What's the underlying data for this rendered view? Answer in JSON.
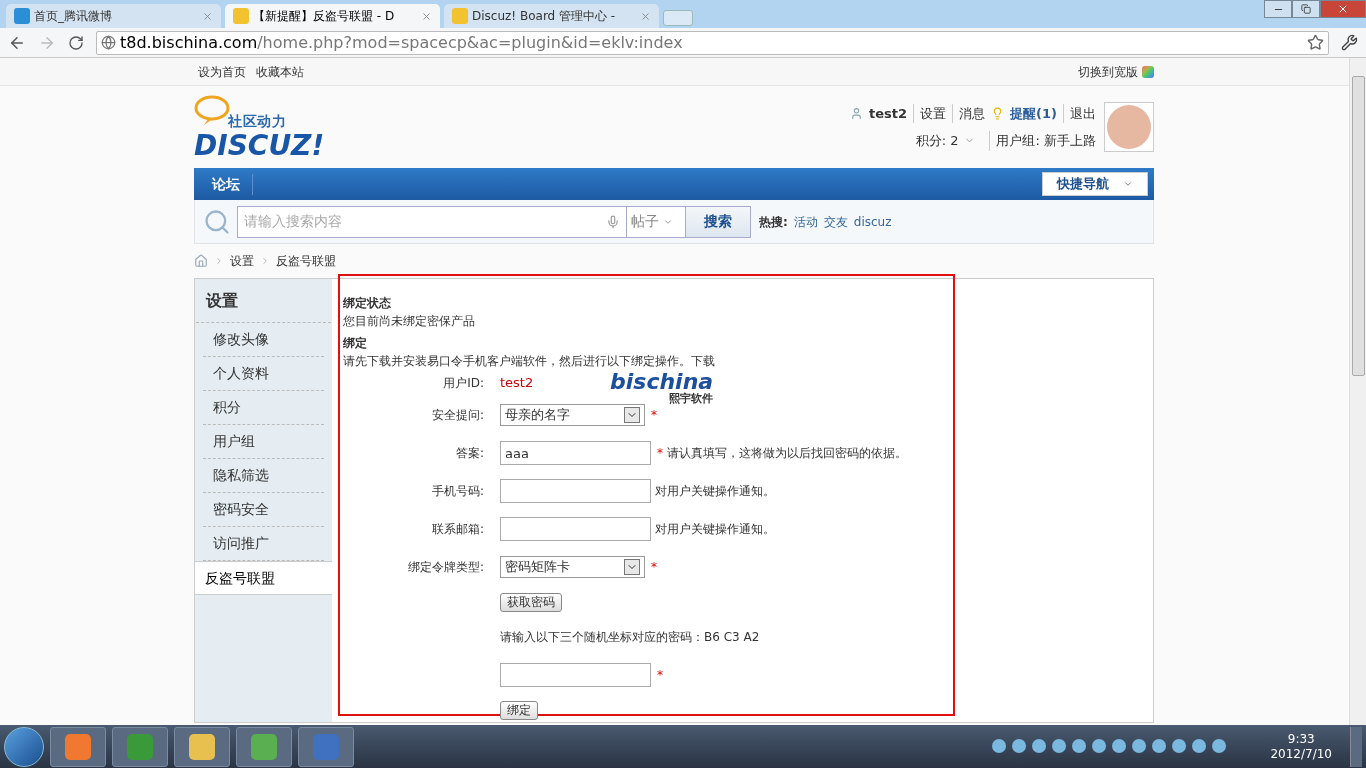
{
  "browser": {
    "tabs": [
      {
        "title": "首页_腾讯微博",
        "selected": false
      },
      {
        "title": "【新提醒】反盗号联盟 - D",
        "selected": true
      },
      {
        "title": "Discuz! Board 管理中心 -",
        "selected": false
      }
    ],
    "url_host": "t8d.bischina.com",
    "url_path": "/home.php?mod=spacecp&ac=plugin&id=eklv:index"
  },
  "topbar": {
    "links": [
      "设为首页",
      "收藏本站"
    ],
    "wide": "切换到宽版"
  },
  "logo": {
    "tagline": "社区动力",
    "name": "DISCUZ!"
  },
  "user": {
    "name": "test2",
    "links": [
      "设置",
      "消息"
    ],
    "alert": "提醒(1)",
    "logout": "退出",
    "credits": "积分: 2",
    "group": "用户组: 新手上路"
  },
  "nav": {
    "items": [
      "论坛"
    ],
    "quick": "快捷导航"
  },
  "search": {
    "placeholder": "请输入搜索内容",
    "type": "帖子",
    "button": "搜索",
    "hot_label": "热搜:",
    "hot": [
      "活动",
      "交友",
      "discuz"
    ]
  },
  "breadcrumb": [
    "设置",
    "反盗号联盟"
  ],
  "sidebar": {
    "title": "设置",
    "items": [
      {
        "label": "修改头像",
        "selected": false
      },
      {
        "label": "个人资料",
        "selected": false
      },
      {
        "label": "积分",
        "selected": false
      },
      {
        "label": "用户组",
        "selected": false
      },
      {
        "label": "隐私筛选",
        "selected": false
      },
      {
        "label": "密码安全",
        "selected": false
      },
      {
        "label": "访问推广",
        "selected": false
      },
      {
        "label": "反盗号联盟",
        "selected": true
      }
    ]
  },
  "content": {
    "status_title": "绑定状态",
    "status_text": "您目前尚未绑定密保产品",
    "bind_title": "绑定",
    "bind_text": "请先下载并安装易口令手机客户端软件，然后进行以下绑定操作。下载",
    "brand": {
      "name": "bischina",
      "sub": "熙宇软件"
    },
    "rows": [
      {
        "kind": "text",
        "label": "用户ID:",
        "value": "test2"
      },
      {
        "kind": "select",
        "label": "安全提问:",
        "value": "母亲的名字",
        "mark": "*"
      },
      {
        "kind": "input",
        "label": "答案:",
        "value": "aaa",
        "mark": "*",
        "hint": "请认真填写，这将做为以后找回密码的依据。"
      },
      {
        "kind": "input",
        "label": "手机号码:",
        "hint": "对用户关键操作通知。"
      },
      {
        "kind": "input",
        "label": "联系邮箱:",
        "hint": "对用户关键操作通知。"
      },
      {
        "kind": "select",
        "label": "绑定令牌类型:",
        "value": "密码矩阵卡",
        "mark": "*"
      },
      {
        "kind": "button",
        "value": "获取密码"
      },
      {
        "kind": "note",
        "value": "请输入以下三个随机坐标对应的密码：B6 C3 A2"
      },
      {
        "kind": "input",
        "mark": "*"
      },
      {
        "kind": "button",
        "value": "绑定"
      }
    ]
  },
  "taskbar": {
    "time": "9:33",
    "date": "2012/7/10"
  }
}
